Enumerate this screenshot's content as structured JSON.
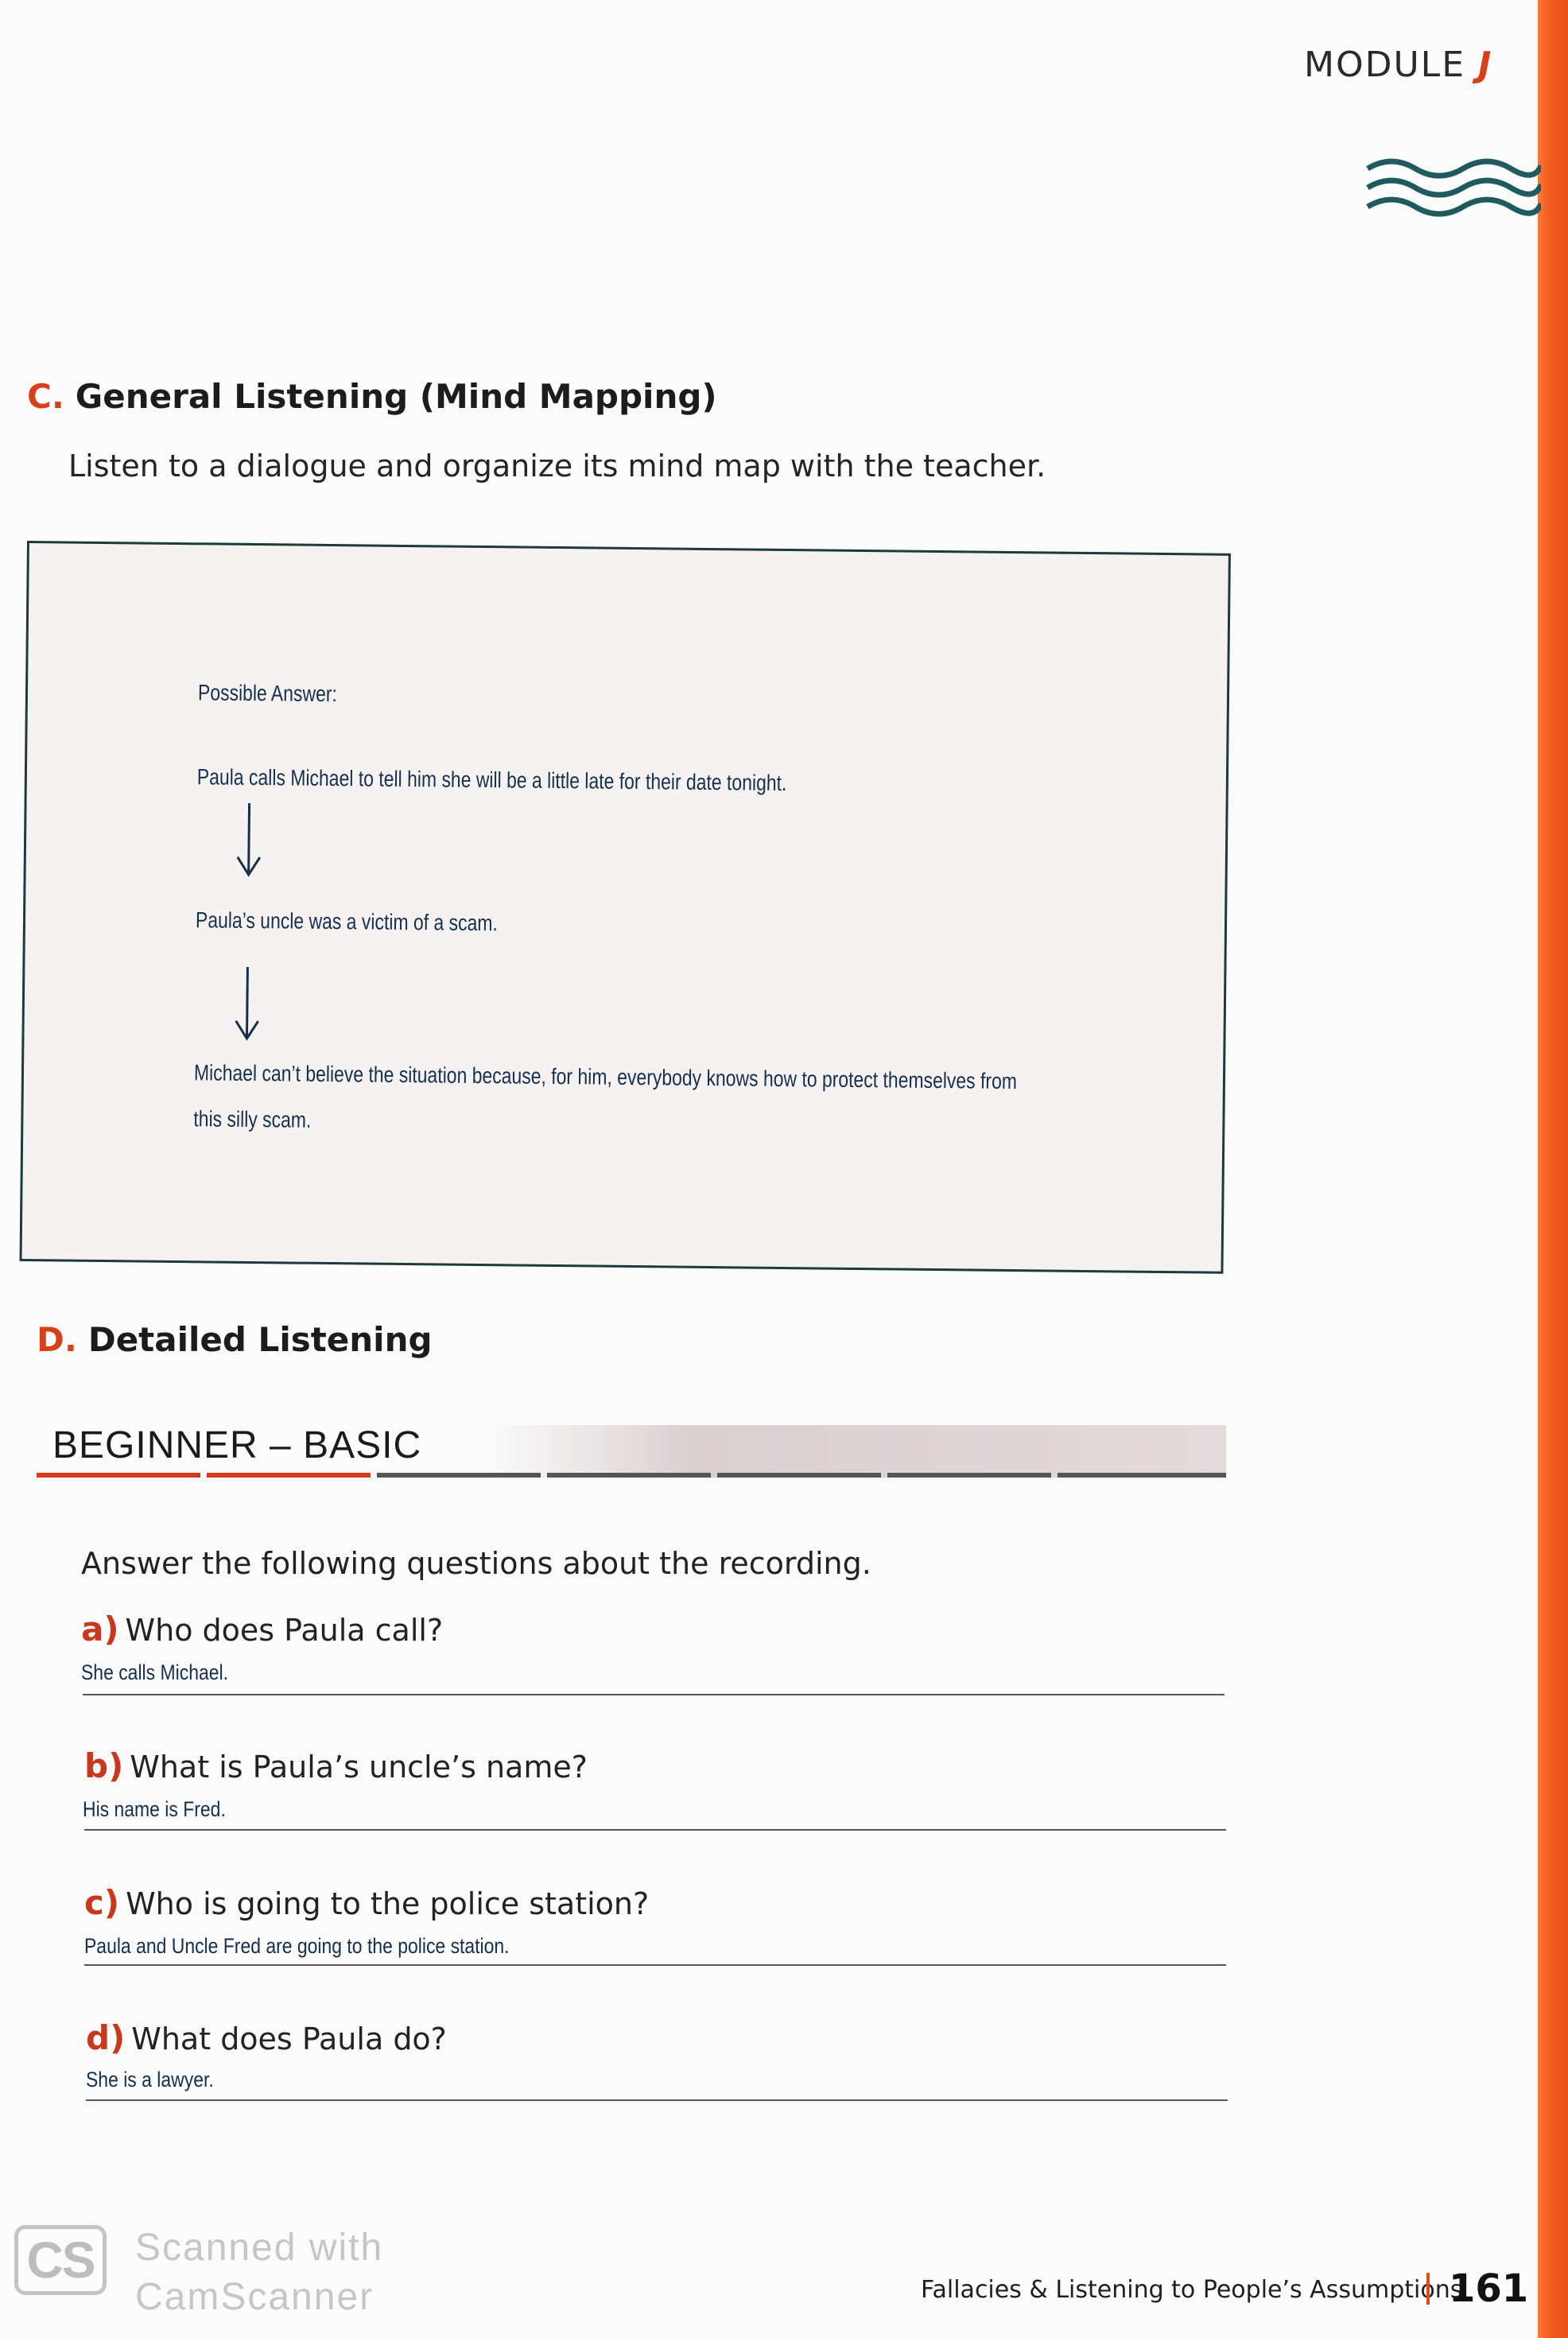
{
  "header": {
    "module_label": "MODULE",
    "module_letter": "J"
  },
  "section_c": {
    "letter": "C.",
    "title": "General Listening (Mind Mapping)",
    "instruction": "Listen to a dialogue and organize its mind map with the teacher.",
    "mind_map": {
      "caption": "Possible Answer:",
      "step1": "Paula calls Michael to tell him she will be a little late for their date tonight.",
      "step2": "Paula’s uncle was a victim of a scam.",
      "step3_line1": "Michael can’t believe the situation because, for him, everybody knows how to protect themselves from",
      "step3_line2": "this silly scam."
    }
  },
  "section_d": {
    "letter": "D.",
    "title": "Detailed Listening",
    "level": "BEGINNER – BASIC",
    "instruction": "Answer the following questions about the recording.",
    "questions": [
      {
        "letter": "a)",
        "question": "Who does Paula call?",
        "answer": "She calls Michael."
      },
      {
        "letter": "b)",
        "question": "What is Paula’s uncle’s name?",
        "answer": "His name is Fred."
      },
      {
        "letter": "c)",
        "question": "Who is going to the police station?",
        "answer": "Paula and Uncle Fred are going to the police station."
      },
      {
        "letter": "d)",
        "question": "What does Paula do?",
        "answer": "She is a lawyer."
      }
    ]
  },
  "watermark": {
    "logo": "CS",
    "line1": "Scanned with",
    "line2": "CamScanner"
  },
  "footer": {
    "chapter_title": "Fallacies & Listening to People’s Assumptions",
    "page_number": "161"
  },
  "colors": {
    "accent": "#d8401c",
    "strip": "#f25a1c",
    "handwriting": "#15304d"
  }
}
